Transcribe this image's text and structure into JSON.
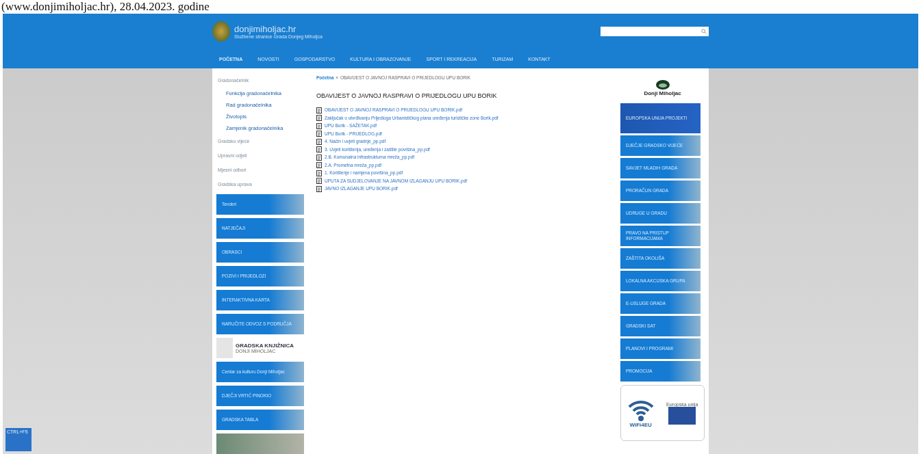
{
  "caption": "(www.donjimiholjac.hr), 28.04.2023. godine",
  "header": {
    "site_name": "donjimiholjac.hr",
    "tagline": "Službene stranice Grada Donjeg Miholjca"
  },
  "nav": [
    {
      "label": "POČETNA",
      "selected": true
    },
    {
      "label": "NOVOSTI",
      "selected": false
    },
    {
      "label": "GOSPODARSTVO",
      "selected": false
    },
    {
      "label": "KULTURA I OBRAZOVANJE",
      "selected": false
    },
    {
      "label": "SPORT I REKREACIJA",
      "selected": false
    },
    {
      "label": "TURIZAM",
      "selected": false
    },
    {
      "label": "KONTAKT",
      "selected": false
    }
  ],
  "sidebar": {
    "items": [
      {
        "label": "Gradonačelnik",
        "children": [
          {
            "label": "Funkcija gradonačelnika"
          },
          {
            "label": "Rad gradonačelnika"
          },
          {
            "label": "Životopis"
          },
          {
            "label": "Zamjenik gradonačelnika"
          }
        ]
      },
      {
        "label": "Gradsko vijeće"
      },
      {
        "label": "Upravni odjeli"
      },
      {
        "label": "Mjesni odbori"
      },
      {
        "label": "Gradska uprava"
      }
    ],
    "banners": [
      {
        "kind": "banner",
        "label": "Tenderi"
      },
      {
        "kind": "banner",
        "label": "NATJEČAJI"
      },
      {
        "kind": "banner",
        "label": "OBRASCI"
      },
      {
        "kind": "banner",
        "label": "POZIVI I PRIJEDLOZI"
      },
      {
        "kind": "banner",
        "label": "INTERAKTIVNA KARTA"
      },
      {
        "kind": "banner",
        "label": "NARUČITE ODVOZ S PODRUČJA"
      },
      {
        "kind": "library",
        "label": "GRADSKA KNJIŽNICA",
        "sub": "DONJI MIHOLJAC"
      },
      {
        "kind": "banner",
        "label": "Centar za kulturu Donji Miholjac"
      },
      {
        "kind": "banner",
        "label": "DJEČJI VRTIĆ PINOKIO"
      },
      {
        "kind": "banner",
        "label": "GRADSKA TABLA"
      },
      {
        "kind": "photo"
      }
    ]
  },
  "breadcrumb": {
    "home": "Početna",
    "separator": "»",
    "current": "OBAVIJEST O JAVNOJ RASPRAVI O PRIJEDLOGU UPU BORIK"
  },
  "title": "OBAVIJEST O JAVNOJ RASPRAVI O PRIJEDLOGU UPU BORIK",
  "files": [
    {
      "name": "OBAVIJEST O JAVNOJ RASPRAVI O PRIJEDLOGU UPU BORIK.pdf"
    },
    {
      "name": "Zaključak o utvrđivanju Prijedloga Urbanističkog plana uređenja turističke zone Borik.pdf"
    },
    {
      "name": "UPU Borik - SAŽETAK.pdf"
    },
    {
      "name": "UPU Borik - PRIJEDLOG.pdf"
    },
    {
      "name": "4. Način i uvjeti gradnje_pp.pdf"
    },
    {
      "name": "3. Uvjeti korištenja, uređenja i zaštite površina_pp.pdf"
    },
    {
      "name": "2.B. Komunalna infrastrukturna mreža_pp.pdf"
    },
    {
      "name": "2.A. Prometna mreža_pp.pdf"
    },
    {
      "name": "1. Korištenje i namjena površina_pp.pdf"
    },
    {
      "name": "UPUTA ZA SUDJELOVANJE NA JAVNOM IZLAGANJU UPU BORIK.pdf"
    },
    {
      "name": "JAVNO IZLAGANJE UPU BORIK.pdf"
    }
  ],
  "right": {
    "logo_text": "Donji Miholjac",
    "banners": [
      {
        "kind": "eu",
        "label": "EUROPSKA UNIJA PROJEKTI"
      },
      {
        "kind": "banner",
        "label": "DJEČJE GRADSKO VIJEĆE"
      },
      {
        "kind": "banner",
        "label": "SAVJET MLADIH GRADA"
      },
      {
        "kind": "banner",
        "label": "PRORAČUN GRADA"
      },
      {
        "kind": "banner",
        "label": "UDRUGE U GRADU"
      },
      {
        "kind": "banner",
        "label": "PRAVO NA PRISTUP INFORMACIJAMA"
      },
      {
        "kind": "banner",
        "label": "ZAŠTITA OKOLIŠA"
      },
      {
        "kind": "banner",
        "label": "LOKALNA AKCIJSKA GRUPA"
      },
      {
        "kind": "banner",
        "label": "E-USLUGE GRADA"
      },
      {
        "kind": "banner",
        "label": "GRADSKI SAT"
      },
      {
        "kind": "banner",
        "label": "PLANOVI I PROGRAMI"
      },
      {
        "kind": "banner",
        "label": "PROMOCIJA"
      }
    ],
    "wifi": {
      "label": "WiFi4EU",
      "eu_text": "Europska unija"
    }
  },
  "corner_badge": "CTRL+F5"
}
